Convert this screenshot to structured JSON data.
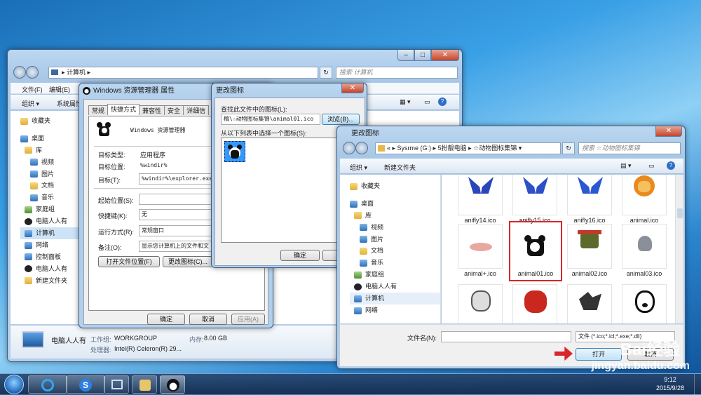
{
  "explorer": {
    "address": "计算机",
    "search_placeholder": "搜索 计算机",
    "menu": [
      "文件(F)",
      "编辑(E)"
    ],
    "toolbar": [
      "组织",
      "系统属性"
    ],
    "nav": [
      "收藏夹",
      "桌面",
      "库",
      "视频",
      "图片",
      "文档",
      "音乐",
      "家庭组",
      "电脑人人有",
      "计算机",
      "网络",
      "控制面板",
      "电脑人人有",
      "新建文件夹"
    ],
    "details": {
      "name": "电脑人人有",
      "workgroup_label": "工作组:",
      "workgroup": "WORKGROUP",
      "memory_label": "内存:",
      "memory": "8.00 GB",
      "cpu_label": "处理器:",
      "cpu": "Intel(R) Celeron(R) 29..."
    }
  },
  "props": {
    "title": "Windows 资源管理器 属性",
    "tabs": [
      "常规",
      "快捷方式",
      "兼容性",
      "安全",
      "详细信"
    ],
    "app_name": "Windows 资源管理器",
    "rows": [
      {
        "label": "目标类型:",
        "value": "应用程序"
      },
      {
        "label": "目标位置:",
        "value": "%windir%"
      },
      {
        "label": "目标(T):",
        "value": "%windir%\\explorer.exe"
      },
      {
        "label": "起始位置(S):",
        "value": ""
      },
      {
        "label": "快捷键(K):",
        "value": "无"
      },
      {
        "label": "运行方式(R):",
        "value": "常规窗口"
      },
      {
        "label": "备注(O):",
        "value": "显示您计算机上的文件和文"
      }
    ],
    "open_location": "打开文件位置(F)",
    "change_icon": "更改图标(C)...",
    "ok": "确定",
    "cancel": "取消",
    "apply": "应用(A)"
  },
  "change_small": {
    "title": "更改图标",
    "find_label": "查找此文件中的图标(L):",
    "path": "稿\\☆动物图标集锦\\animal01.ico",
    "browse": "浏览(B)...",
    "select_label": "从以下列表中选择一个图标(S):",
    "ok": "确定",
    "cancel": "取"
  },
  "change_big": {
    "title": "更改图标",
    "breadcrumb": [
      "«",
      "Sysrme (G:)",
      "5扮靓电脑",
      "☆动物图标集锦"
    ],
    "search_placeholder": "搜索 ☆动物图标集锦",
    "toolbar": [
      "组织",
      "新建文件夹"
    ],
    "nav": [
      "收藏夹",
      "桌面",
      "库",
      "视频",
      "图片",
      "文档",
      "音乐",
      "家庭组",
      "电脑人人有",
      "计算机",
      "网络"
    ],
    "files": [
      "anifly14.ico",
      "anifly15.ico",
      "anifly16.ico",
      "animal.ico",
      "animal+.ico",
      "animal01.ico",
      "animal02.ico",
      "animal03.ico",
      "",
      "",
      "",
      ""
    ],
    "filename_label": "文件名(N):",
    "filetype": "文件 (*.ico;*.icl;*.exe;*.dll)",
    "open": "打开",
    "cancel": "取消"
  },
  "taskbar": {
    "time": "9:12",
    "date": "2015/9/28"
  },
  "watermark": "jingyan.baidu.com"
}
